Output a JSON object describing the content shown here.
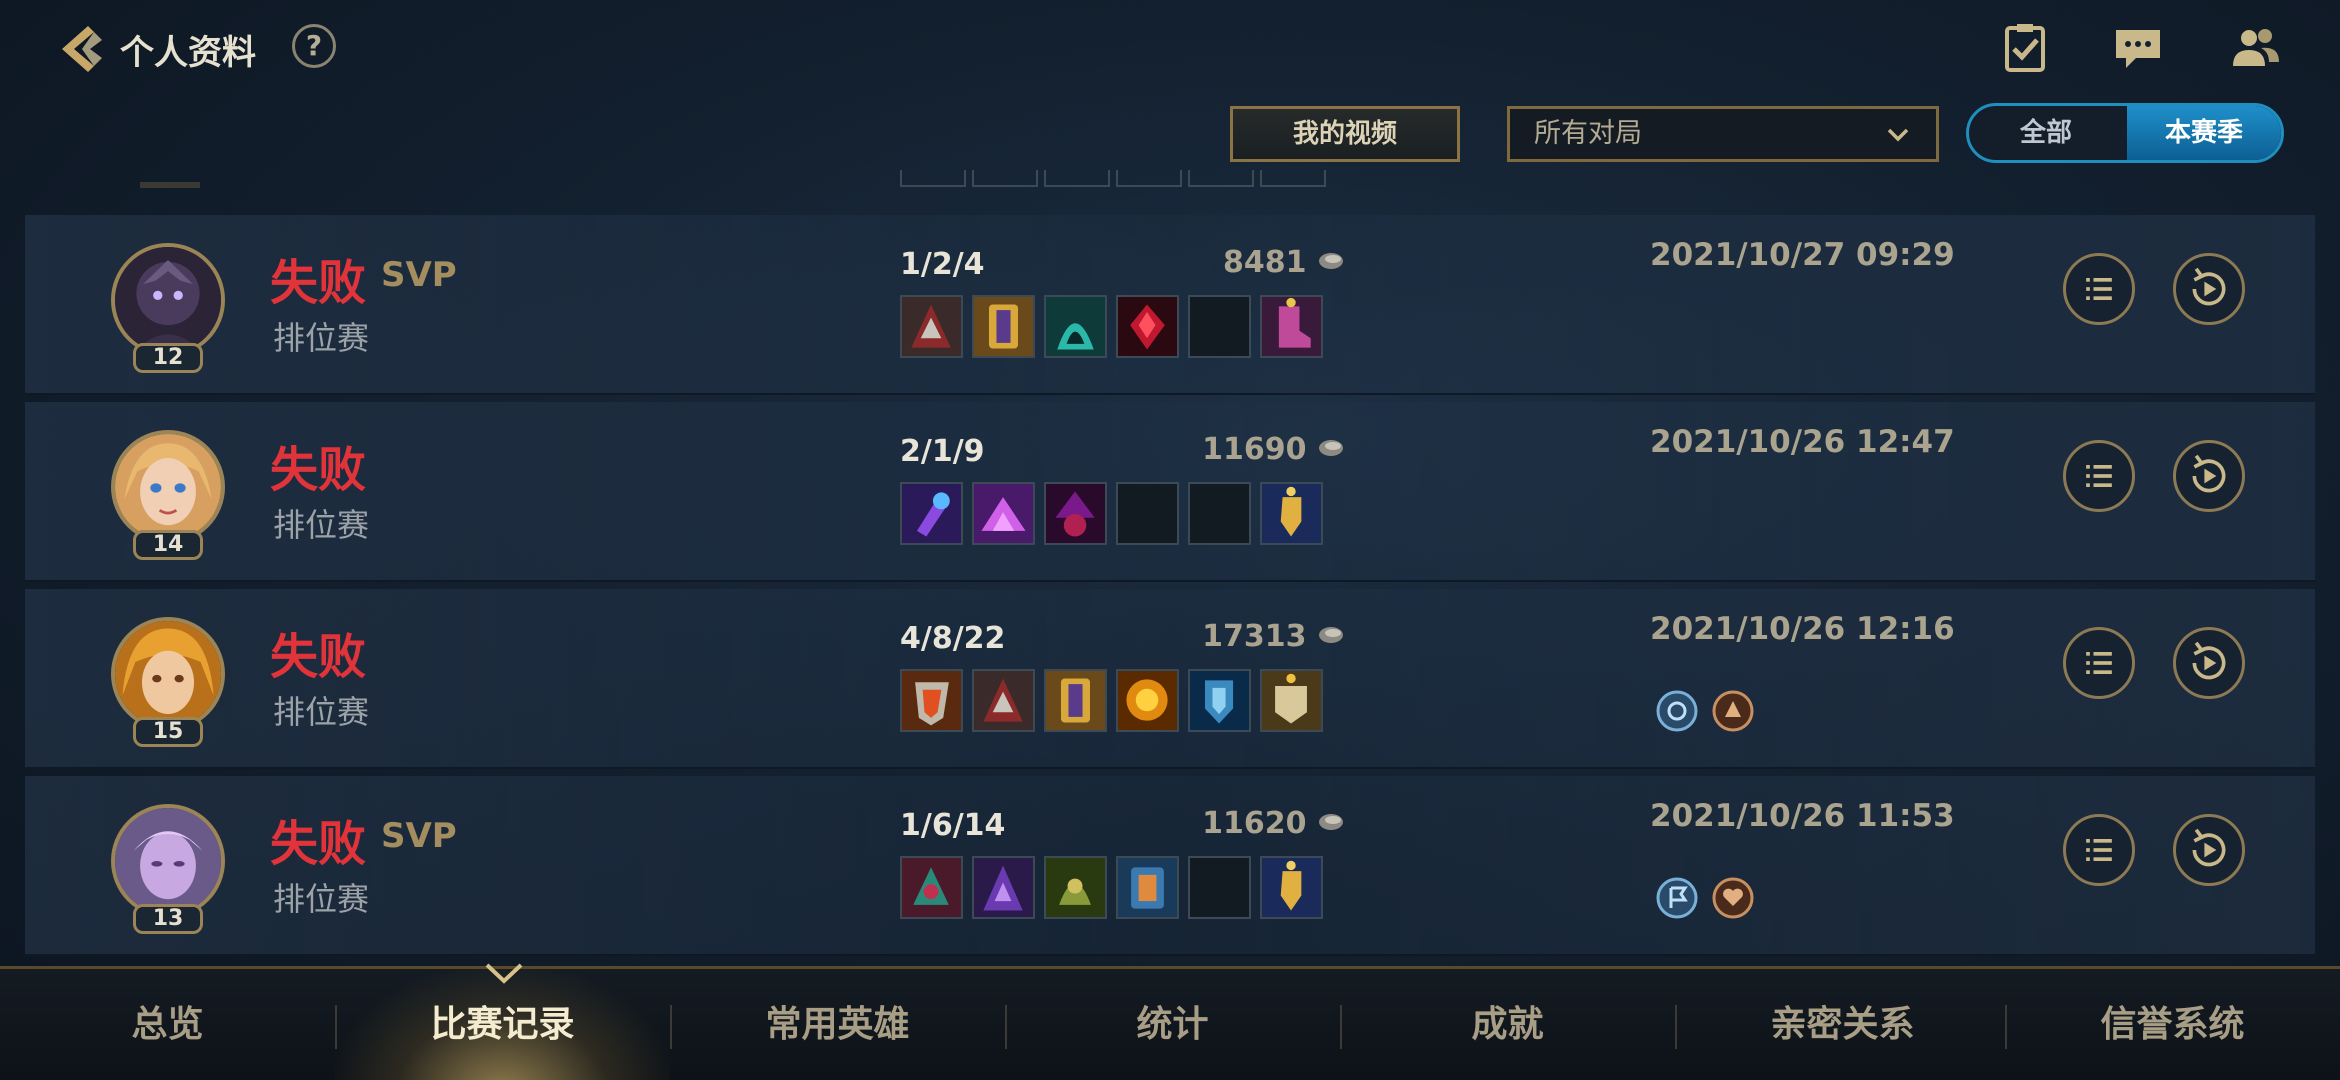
{
  "header": {
    "title": "个人资料",
    "help_label": "?"
  },
  "filters": {
    "video_button": "我的视频",
    "match_filter_value": "所有对局",
    "season_all": "全部",
    "season_current": "本赛季"
  },
  "matches": [
    {
      "level": "12",
      "result": "失败",
      "svp": "SVP",
      "mode": "排位赛",
      "kda": "1/2/4",
      "gold": "8481",
      "date": "2021/10/27 09:29"
    },
    {
      "level": "14",
      "result": "失败",
      "svp": "",
      "mode": "排位赛",
      "kda": "2/1/9",
      "gold": "11690",
      "date": "2021/10/26 12:47"
    },
    {
      "level": "15",
      "result": "失败",
      "svp": "",
      "mode": "排位赛",
      "kda": "4/8/22",
      "gold": "17313",
      "date": "2021/10/26 12:16"
    },
    {
      "level": "13",
      "result": "失败",
      "svp": "SVP",
      "mode": "排位赛",
      "kda": "1/6/14",
      "gold": "11620",
      "date": "2021/10/26 11:53"
    }
  ],
  "bottom_nav": [
    "总览",
    "比赛记录",
    "常用英雄",
    "统计",
    "成就",
    "亲密关系",
    "信誉系统"
  ],
  "bottom_nav_active": "比赛记录",
  "icons": {
    "back": "back-arrow-icon",
    "tasks": "clipboard-check-icon",
    "chat": "chat-bubble-icon",
    "friends": "friends-icon",
    "details": "list-icon",
    "replay": "replay-icon",
    "gold": "gold-coin-icon"
  },
  "colors": {
    "loss": "#e0343a",
    "svp": "#a48d5e",
    "accent_blue": "#1f8fc9",
    "gold_border": "#9b8455"
  }
}
